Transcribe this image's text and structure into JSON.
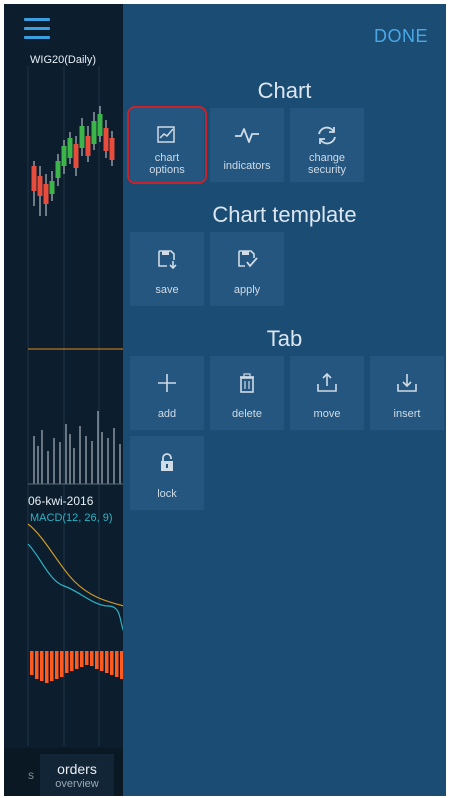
{
  "chart": {
    "title": "WIG20(Daily)",
    "date": "06-kwi-2016",
    "macd_label": "MACD(12, 26, 9)"
  },
  "bottom_tabs": {
    "cut_label": "s",
    "orders_line1": "orders",
    "orders_line2": "overview"
  },
  "panel": {
    "done_label": "DONE",
    "chart_section": {
      "title": "Chart",
      "items": [
        {
          "label1": "chart",
          "label2": "options",
          "icon": "chart-options-icon"
        },
        {
          "label1": "indicators",
          "label2": "",
          "icon": "indicators-icon"
        },
        {
          "label1": "change",
          "label2": "security",
          "icon": "change-security-icon"
        }
      ]
    },
    "template_section": {
      "title": "Chart template",
      "items": [
        {
          "label1": "save",
          "icon": "save-template-icon"
        },
        {
          "label1": "apply",
          "icon": "apply-template-icon"
        }
      ]
    },
    "tab_section": {
      "title": "Tab",
      "items": [
        {
          "label1": "add",
          "icon": "plus-icon"
        },
        {
          "label1": "delete",
          "icon": "trash-icon"
        },
        {
          "label1": "move",
          "icon": "upload-icon"
        },
        {
          "label1": "insert",
          "icon": "download-icon"
        },
        {
          "label1": "lock",
          "icon": "lock-icon"
        }
      ]
    }
  },
  "colors": {
    "panel_bg": "#1b4c74",
    "tile_bg": "#24567f",
    "accent": "#4aa8e6",
    "highlight": "#c8222a",
    "candle_up": "#3bb54a",
    "candle_down": "#e84c3d",
    "macd_histogram": "#ff5a1f"
  }
}
